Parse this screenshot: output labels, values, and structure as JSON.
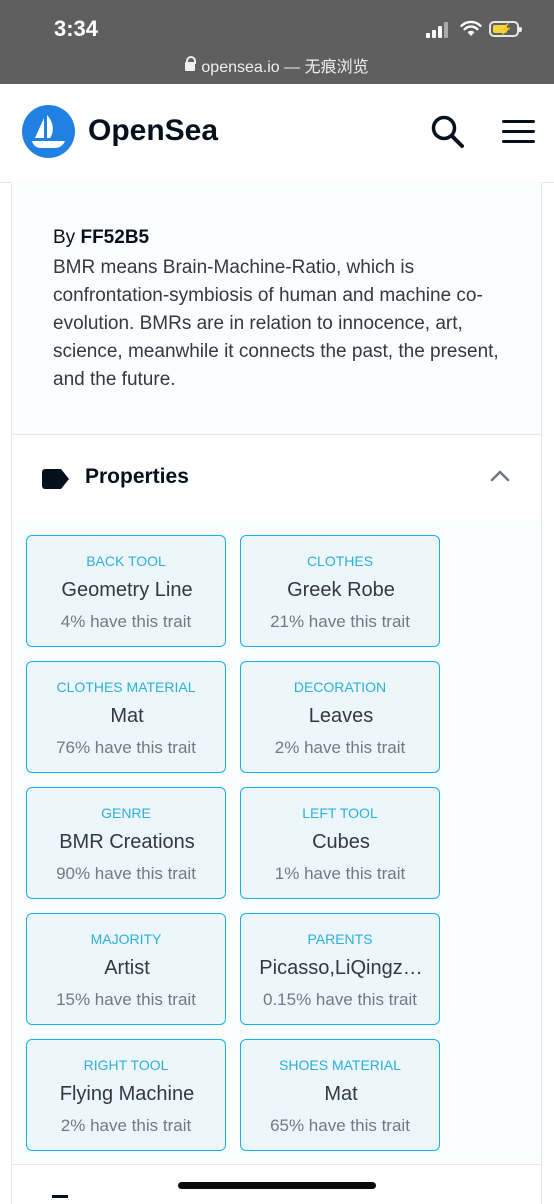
{
  "status_bar": {
    "time": "3:34",
    "url": "opensea.io — 无痕浏览"
  },
  "header": {
    "brand": "OpenSea",
    "brand_color": "#2081e2"
  },
  "description": {
    "by_prefix": "By",
    "creator": "FF52B5",
    "text": "BMR means Brain-Machine-Ratio, which is confrontation-symbiosis of human and machine co-evolution. BMRs are in relation to innocence, art, science, meanwhile it connects the past, the present, and the future."
  },
  "properties": {
    "title": "Properties",
    "traits": [
      {
        "type": "BACK TOOL",
        "value": "Geometry Line",
        "rarity": "4% have this trait"
      },
      {
        "type": "CLOTHES",
        "value": "Greek Robe",
        "rarity": "21% have this trait"
      },
      {
        "type": "CLOTHES MATERIAL",
        "value": "Mat",
        "rarity": "76% have this trait"
      },
      {
        "type": "DECORATION",
        "value": "Leaves",
        "rarity": "2% have this trait"
      },
      {
        "type": "GENRE",
        "value": "BMR Creations",
        "rarity": "90% have this trait"
      },
      {
        "type": "LEFT TOOL",
        "value": "Cubes",
        "rarity": "1% have this trait"
      },
      {
        "type": "MAJORITY",
        "value": "Artist",
        "rarity": "15% have this trait"
      },
      {
        "type": "PARENTS",
        "value": "Picasso,LiQingz…",
        "rarity": "0.15% have this trait"
      },
      {
        "type": "RIGHT TOOL",
        "value": "Flying Machine",
        "rarity": "2% have this trait"
      },
      {
        "type": "SHOES MATERIAL",
        "value": "Mat",
        "rarity": "65% have this trait"
      }
    ]
  }
}
